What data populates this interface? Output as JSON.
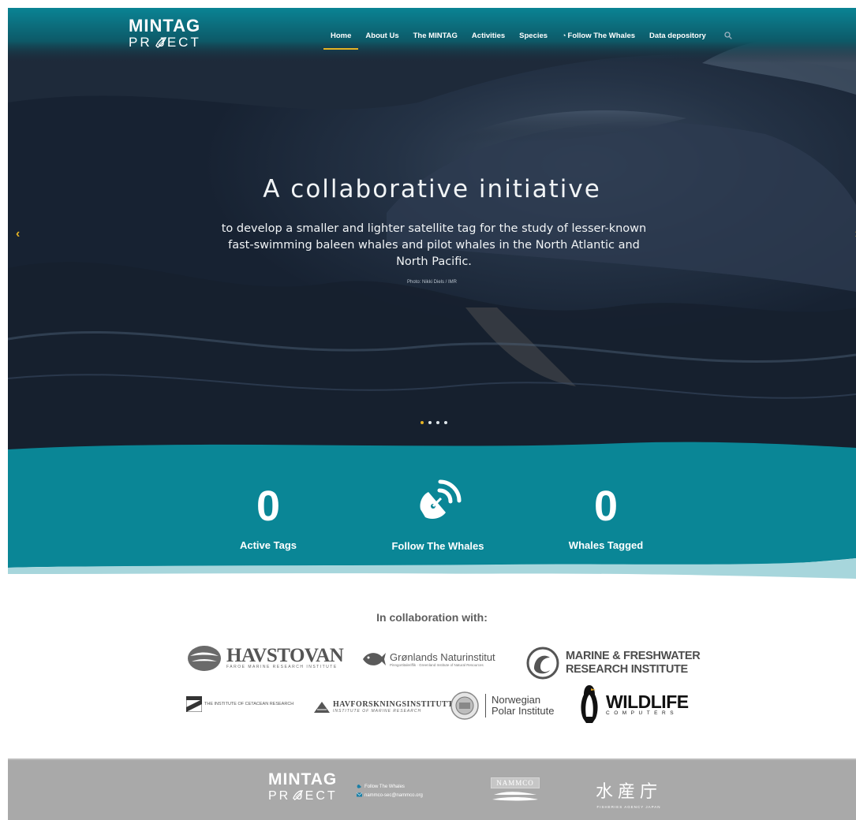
{
  "brand": {
    "logo_top": "MINTAG",
    "logo_bottom": "PR  JECT"
  },
  "nav": {
    "items": [
      {
        "label": "Home",
        "active": true
      },
      {
        "label": "About Us",
        "active": false
      },
      {
        "label": "The MINTAG",
        "active": false
      },
      {
        "label": "Activities",
        "active": false
      },
      {
        "label": "Species",
        "active": false
      },
      {
        "label": "Follow The Whales",
        "active": false
      },
      {
        "label": "Data depository",
        "active": false
      }
    ],
    "search_icon": "search-icon"
  },
  "hero": {
    "headline": "A collaborative initiative",
    "subline": "to develop a smaller and lighter satellite tag for the study of lesser-known fast-swimming baleen whales and pilot whales in the North Atlantic and North Pacific.",
    "credit": "Photo: Nikki Diels / IMR",
    "prev_glyph": "‹",
    "next_glyph": "›",
    "slide_count": 4,
    "active_slide": 1
  },
  "stats": {
    "active_tags": {
      "value": "0",
      "label": "Active Tags"
    },
    "follow": {
      "label": "Follow The Whales"
    },
    "whales_tagged": {
      "value": "0",
      "label": "Whales Tagged"
    }
  },
  "collab": {
    "title": "In collaboration with:",
    "havstovan": {
      "name": "HAVSTOVAN",
      "sub": "FAROE MARINE RESEARCH INSTITUTE"
    },
    "greenland": {
      "name": "Grønlands Naturinstitut",
      "sub": "Pinngortitaleriffik · Greenland Institute of Natural Resources"
    },
    "mfri": {
      "line1": "MARINE & FRESHWATER",
      "line2": "RESEARCH INSTITUTE"
    },
    "icr": {
      "name": "THE INSTITUTE OF CETACEAN RESEARCH"
    },
    "imr": {
      "name": "HAVFORSKNINGSINSTITUTTET",
      "sub": "INSTITUTE OF MARINE RESEARCH"
    },
    "npi": {
      "line1": "Norwegian",
      "line2": "Polar Institute"
    },
    "wildlife": {
      "name": "WILDLIFE",
      "sub": "COMPUTERS"
    }
  },
  "footer": {
    "logo_top": "MINTAG",
    "logo_bottom": "PR  JECT",
    "link_follow": "Follow The Whales",
    "link_email": "nammco-sec@nammco.org",
    "nammco": "NAMMCO",
    "agency_jp": "水産庁",
    "agency_en": "FISHERIES AGENCY JAPAN"
  },
  "colors": {
    "teal": "#0a8696",
    "accent": "#e5b324",
    "footer": "#a9a9a9"
  }
}
